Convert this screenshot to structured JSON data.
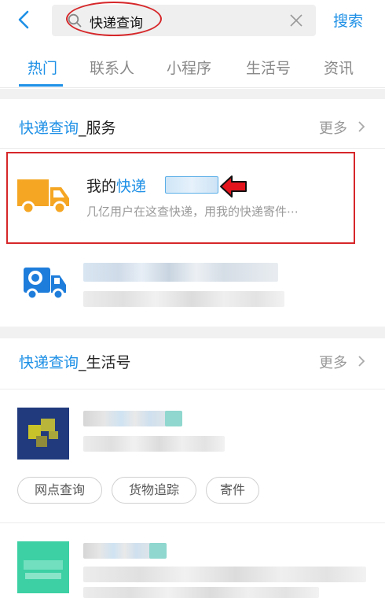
{
  "search": {
    "query": "快递查询",
    "submit_label": "搜索"
  },
  "tabs": [
    {
      "label": "热门",
      "active": true
    },
    {
      "label": "联系人",
      "active": false
    },
    {
      "label": "小程序",
      "active": false
    },
    {
      "label": "生活号",
      "active": false
    },
    {
      "label": "资讯",
      "active": false
    }
  ],
  "service_section": {
    "title_keyword": "快递查询",
    "title_rest": "_服务",
    "more_label": "更多",
    "items": [
      {
        "title_prefix": "我的",
        "title_keyword": "快递",
        "description": "几亿用户在这查快递，用我的快递寄件⋯",
        "icon": "orange-truck-icon"
      },
      {
        "icon": "blue-truck-icon"
      }
    ]
  },
  "life_section": {
    "title_keyword": "快递查询",
    "title_rest": "_生活号",
    "more_label": "更多",
    "chips": [
      "网点查询",
      "货物追踪",
      "寄件"
    ],
    "items": [
      {
        "logo_colors": [
          "#203a7d",
          "#c9c32a"
        ]
      },
      {
        "logo_colors": [
          "#3cd0a4"
        ]
      }
    ]
  },
  "colors": {
    "accent": "#1e90e6",
    "annotation_red": "#d6272a",
    "truck_orange": "#f5a623",
    "truck_blue": "#1e7ddb"
  }
}
